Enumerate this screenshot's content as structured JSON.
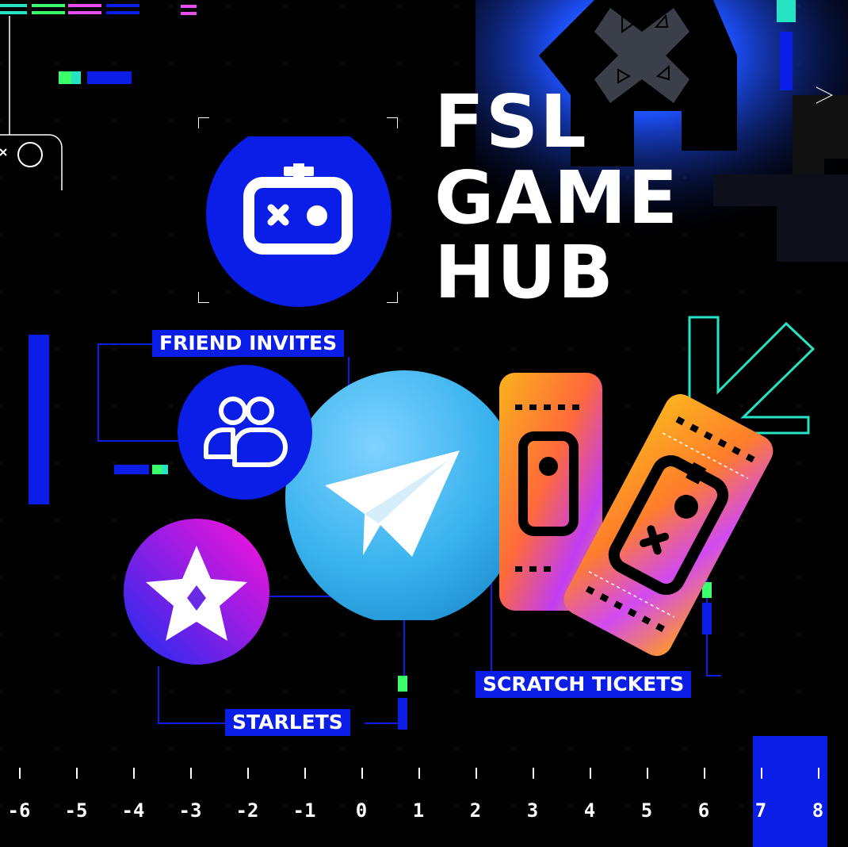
{
  "title": {
    "line1": "FSL",
    "line2": "GAME",
    "line3": "HUB"
  },
  "labels": {
    "friend_invites": "FRIEND INVITES",
    "starlets": "STARLETS",
    "scratch_tickets": "SCRATCH TICKETS"
  },
  "axis": {
    "ticks": [
      "-6",
      "-5",
      "-4",
      "-3",
      "-2",
      "-1",
      "0",
      "1",
      "2",
      "3",
      "4",
      "5",
      "6",
      "7",
      "8"
    ]
  },
  "colors": {
    "brand_blue": "#0a1ee8",
    "telegram_blue": "#3ab3ee",
    "magenta": "#ff12d9",
    "ticket_orange": "#f6a51e",
    "teal_outline": "#26e3c3"
  },
  "icons": {
    "hub": "gamepad-icon",
    "friends": "two-people-icon",
    "starlets": "star-icon",
    "center": "telegram-paper-plane-icon",
    "tickets": "scratch-ticket-icon"
  }
}
